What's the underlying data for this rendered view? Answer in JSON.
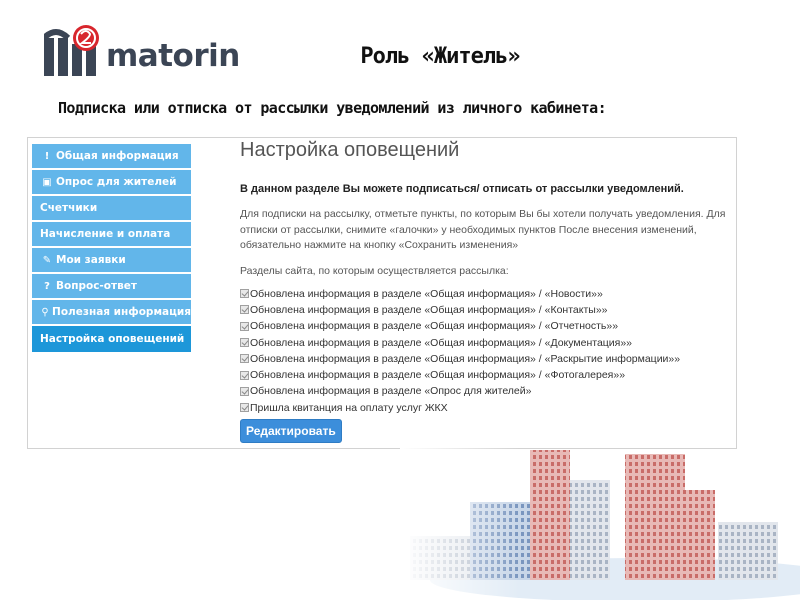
{
  "logo": {
    "text": "matorin"
  },
  "slide": {
    "title": "Роль «Житель»",
    "subtitle": "Подписка или отписка от рассылки уведомлений из личного кабинета:"
  },
  "sidebar": {
    "items": [
      {
        "icon": "exclamation-icon",
        "glyph": "!",
        "label": "Общая информация"
      },
      {
        "icon": "survey-icon",
        "glyph": "▣",
        "label": "Опрос для жителей"
      },
      {
        "icon": "",
        "glyph": "",
        "label": "Счетчики"
      },
      {
        "icon": "",
        "glyph": "",
        "label": "Начисление и оплата"
      },
      {
        "icon": "edit-icon",
        "glyph": "✎",
        "label": "Мои заявки"
      },
      {
        "icon": "question-icon",
        "glyph": "?",
        "label": "Вопрос-ответ"
      },
      {
        "icon": "pin-icon",
        "glyph": "⚲",
        "label": "Полезная информация"
      },
      {
        "icon": "",
        "glyph": "",
        "label": "Настройка оповещений",
        "active": true
      }
    ]
  },
  "content": {
    "title": "Настройка оповещений",
    "lead": "В данном разделе Вы можете подписаться/ отписать от рассылки уведомлений.",
    "paragraph": "Для подписки на рассылку, отметьте пункты, по которым Вы бы хотели получать уведомления. Для отписки от рассылки, снимите «галочки» у необходимых пунктов После внесения изменений, обязательно нажмите на кнопку «Сохранить изменения»",
    "sections_label": "Разделы сайта, по которым осуществляется рассылка:",
    "options": [
      {
        "label": "Обновлена информация в разделе «Общая информация» / «Новости»»",
        "checked": true
      },
      {
        "label": "Обновлена информация в разделе «Общая информация» / «Контакты»»",
        "checked": true
      },
      {
        "label": "Обновлена информация в разделе «Общая информация» / «Отчетность»»",
        "checked": true
      },
      {
        "label": "Обновлена информация в разделе «Общая информация» / «Документация»»",
        "checked": true
      },
      {
        "label": "Обновлена информация в разделе «Общая информация» / «Раскрытие информации»»",
        "checked": true
      },
      {
        "label": "Обновлена информация в разделе «Общая информация» / «Фотогалерея»»",
        "checked": true
      },
      {
        "label": "Обновлена информация в разделе «Опрос для жителей»",
        "checked": true
      },
      {
        "label": "Пришла квитанция на оплату услуг ЖКХ",
        "checked": true
      }
    ],
    "edit_button": "Редактировать"
  },
  "colors": {
    "nav": "#62b6ea",
    "nav_active": "#1d97d9",
    "button": "#3c8edb",
    "logo_red": "#d8262d",
    "logo_navy": "#3b4555"
  }
}
